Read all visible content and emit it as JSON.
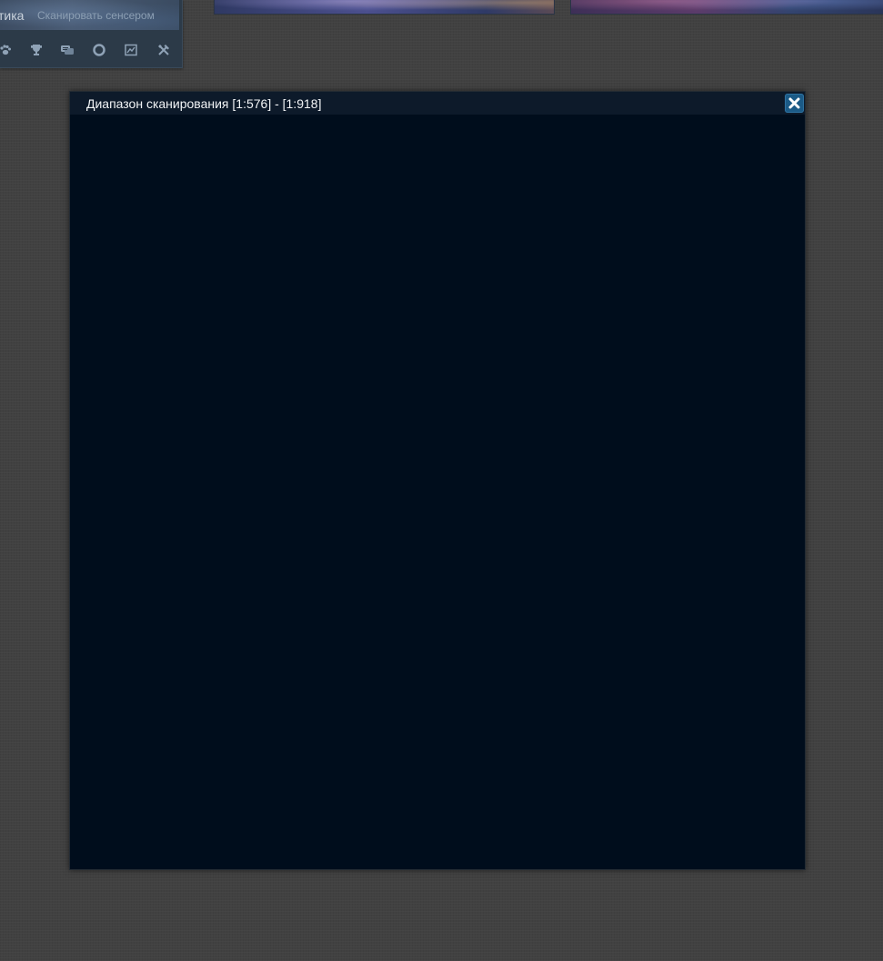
{
  "background": {
    "left_panel": {
      "tab_label": "тика",
      "link_label": "Сканировать сенсером",
      "icons": [
        "paw-icon",
        "trophy-icon",
        "chat-icon",
        "lifebuoy-icon",
        "map-icon",
        "tools-icon"
      ]
    }
  },
  "dialog": {
    "title": "Диапазон сканирования [1:576] - [1:918]",
    "close_icon": "close-icon",
    "body_color": "#000d1c",
    "header_color": "#0d1a2a",
    "close_button_color": "#1b5a86"
  }
}
